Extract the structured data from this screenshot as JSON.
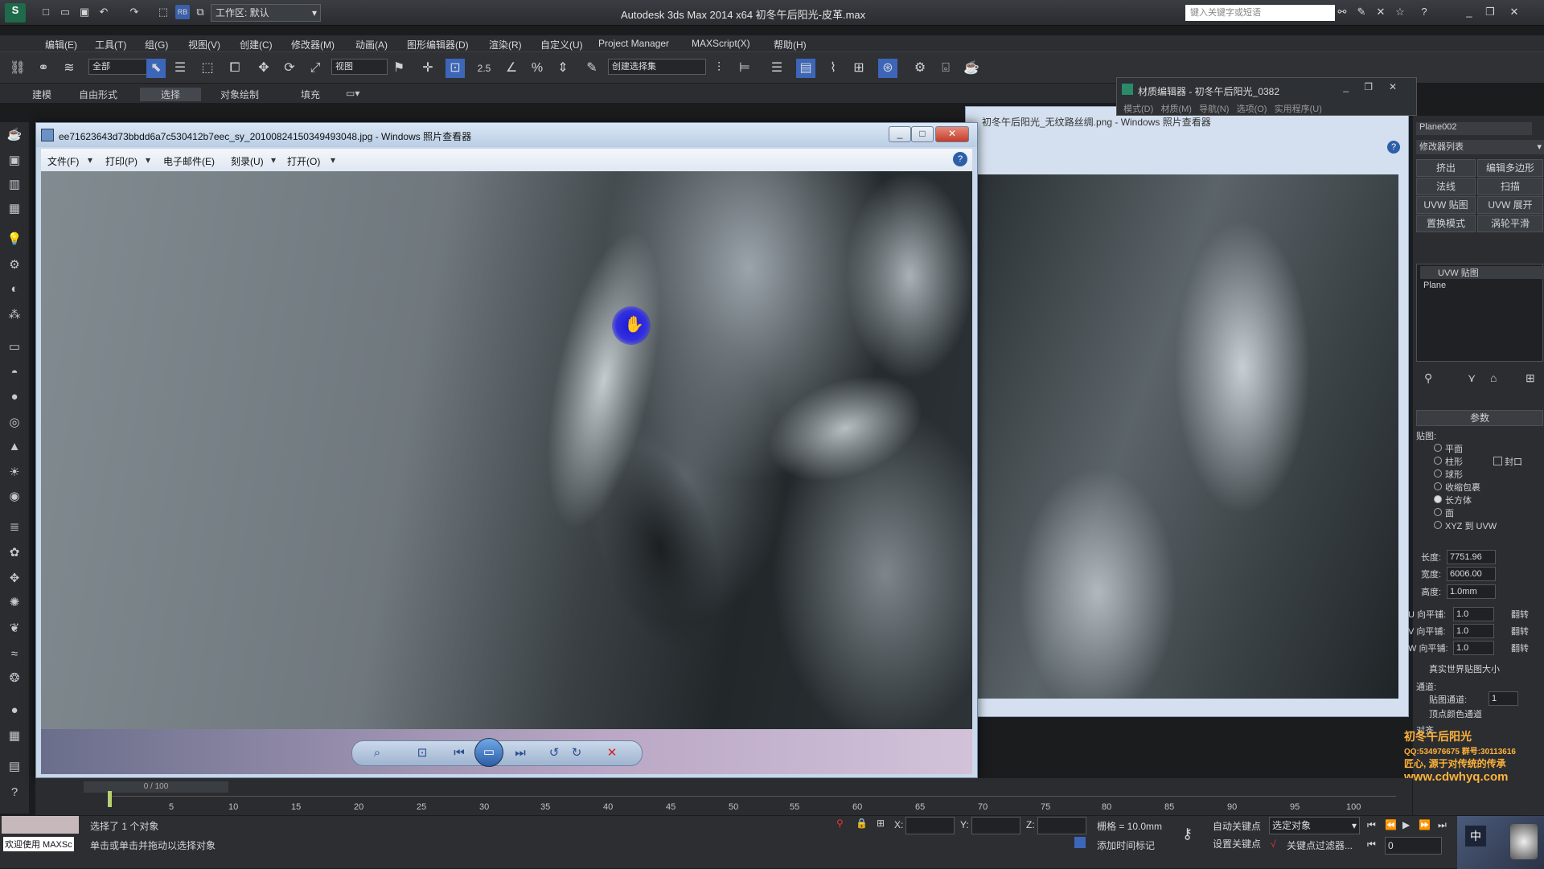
{
  "app": {
    "title": "Autodesk 3ds Max  2014 x64     初冬午后阳光-皮革.max",
    "workspace": "工作区: 默认",
    "search_placeholder": "键入关键字或短语"
  },
  "menu": [
    "编辑(E)",
    "工具(T)",
    "组(G)",
    "视图(V)",
    "创建(C)",
    "修改器(M)",
    "动画(A)",
    "图形编辑器(D)",
    "渲染(R)",
    "自定义(U)",
    "Project Manager",
    "MAXScript(X)",
    "帮助(H)"
  ],
  "toolbar": {
    "selection_filter": "全部",
    "ref_coord": "视图",
    "snap_value": "2.5",
    "named_selection": "创建选择集"
  },
  "ribbon_tabs": [
    "建模",
    "自由形式",
    "选择",
    "对象绘制",
    "填充"
  ],
  "ribbon_active": "选择",
  "photo_viewer": {
    "title": "ee71623643d73bbdd6a7c530412b7eec_sy_20100824150349493048.jpg - Windows 照片查看器",
    "menu": [
      "文件(F)",
      "打印(P)",
      "电子邮件(E)",
      "刻录(U)",
      "打开(O)"
    ],
    "back_title": "初冬午后阳光_无纹路丝绸.png - Windows 照片查看器"
  },
  "material_editor": {
    "title": "材质编辑器 - 初冬午后阳光_0382",
    "menu": [
      "模式(D)",
      "材质(M)",
      "导航(N)",
      "选项(O)",
      "实用程序(U)"
    ]
  },
  "command_panel": {
    "object_name": "Plane002",
    "modifier_list": "修改器列表",
    "buttons": [
      "挤出",
      "编辑多边形",
      "法线",
      "扫描",
      "UVW 贴图",
      "UVW 展开",
      "置换模式",
      "涡轮平滑"
    ],
    "stack": [
      "UVW 贴图",
      "Plane"
    ],
    "rollout": "参数",
    "mapping_label": "贴图:",
    "mapping_options": [
      "平面",
      "柱形",
      "封口",
      "球形",
      "收缩包裹",
      "长方体",
      "面",
      "XYZ 到 UVW"
    ],
    "mapping_selected": "长方体",
    "length_label": "长度:",
    "length": "7751.96",
    "width_label": "宽度:",
    "width": "6006.00",
    "height_label": "高度:",
    "height": "1.0mm",
    "u_tile_label": "U 向平铺:",
    "u_tile": "1.0",
    "v_tile_label": "V 向平铺:",
    "v_tile": "1.0",
    "w_tile_label": "W 向平铺:",
    "w_tile": "1.0",
    "flip_label": "翻转",
    "real_world": "真实世界贴图大小",
    "channel_label": "通道:",
    "map_channel_label": "贴图通道:",
    "map_channel": "1",
    "vertex_color": "顶点颜色通道",
    "align_label": "对齐"
  },
  "timeline": {
    "frame_display": "0 / 100",
    "ticks": [
      "5",
      "10",
      "15",
      "20",
      "25",
      "30",
      "35",
      "40",
      "45",
      "50",
      "55",
      "60",
      "65",
      "70",
      "75",
      "80",
      "85",
      "90",
      "95",
      "100"
    ]
  },
  "status": {
    "welcome": "欢迎使用 MAXSc",
    "selected": "选择了 1 个对象",
    "prompt": "单击或单击并拖动以选择对象",
    "x_label": "X:",
    "y_label": "Y:",
    "z_label": "Z:",
    "grid": "栅格 = 10.0mm",
    "auto_key": "自动关键点",
    "set_key": "设置关键点",
    "selected_filter": "选定对象",
    "key_filters": "关键点过滤器...",
    "add_time_tag": "添加时间标记",
    "frame": "0"
  },
  "watermark": {
    "line1": "初冬午后阳光",
    "line2": "QQ:534976675  群号:30113616",
    "line3": "匠心, 源于对传统的传承",
    "line4": "www.cdwhyq.com"
  },
  "colors": {
    "accent": "#1f5fbf",
    "ui_dark": "#2b2d31",
    "cursor_highlight": "#1a16d6"
  }
}
